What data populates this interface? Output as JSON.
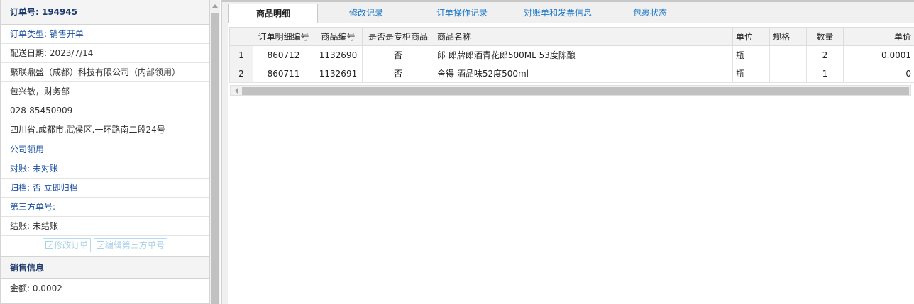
{
  "order": {
    "title": "订单号: 194945",
    "type": "订单类型: 销售开单",
    "date": "配送日期: 2023/7/14",
    "company": "聚联鼎盛（成都）科技有限公司（内部领用）",
    "contact": "包兴敏，财务部",
    "phone": "028-85450909",
    "address": "四川省.成都市.武侯区.一环路南二段24号",
    "usage": "公司领用",
    "reconcile": "对账: 未对账",
    "archive": "归档:  否 立即归档",
    "third_party": "第三方单号:",
    "settle": "结账: 未结账",
    "edit_order_btn": "修改订单",
    "edit_third_btn": "编辑第三方单号"
  },
  "sales": {
    "title": "销售信息",
    "amount": "金额: 0.0002"
  },
  "tabs": [
    {
      "label": "商品明细"
    },
    {
      "label": "修改记录"
    },
    {
      "label": "订单操作记录"
    },
    {
      "label": "对账单和发票信息"
    },
    {
      "label": "包裹状态"
    }
  ],
  "grid": {
    "headers": [
      "订单明细编号",
      "商品编号",
      "是否是专柜商品",
      "商品名称",
      "单位",
      "规格",
      "数量",
      "单价"
    ],
    "rows": [
      {
        "n": "1",
        "detail_id": "860712",
        "product_id": "1132690",
        "is_counter": "否",
        "name": "郎 郎牌郎酒青花郎500ML 53度陈酿",
        "unit": "瓶",
        "spec": "",
        "qty": "2",
        "price": "0.0001"
      },
      {
        "n": "2",
        "detail_id": "860711",
        "product_id": "1132691",
        "is_counter": "否",
        "name": "舍得 酒品味52度500ml",
        "unit": "瓶",
        "spec": "",
        "qty": "1",
        "price": "0"
      }
    ]
  },
  "colors": {
    "link": "#1a2fc0",
    "tab_link": "#1c78c6",
    "label_blue": "#1a4fa0"
  }
}
